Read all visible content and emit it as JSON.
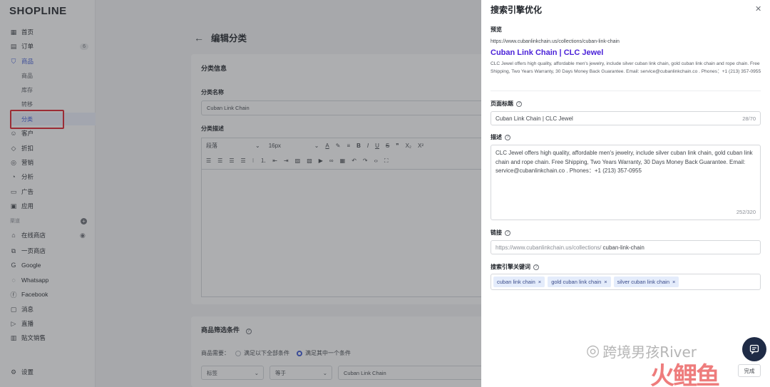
{
  "app": {
    "logo": "SHOPLINE"
  },
  "sidebar": {
    "items": [
      {
        "label": "首页",
        "icon": "dashboard-icon"
      },
      {
        "label": "订单",
        "icon": "order-icon",
        "badge": "6"
      },
      {
        "label": "商品",
        "icon": "bag-icon"
      },
      {
        "label": "客户",
        "icon": "user-icon"
      },
      {
        "label": "折扣",
        "icon": "tag-icon"
      },
      {
        "label": "营销",
        "icon": "marketing-icon"
      },
      {
        "label": "分析",
        "icon": "analytics-icon"
      },
      {
        "label": "广告",
        "icon": "ads-icon"
      },
      {
        "label": "应用",
        "icon": "apps-icon"
      }
    ],
    "sub_items": [
      "商品",
      "库存",
      "转移",
      "分类"
    ],
    "channel_label": "渠道",
    "channels": [
      {
        "label": "在线商店",
        "icon": "store-icon"
      },
      {
        "label": "一页商店",
        "icon": "onepage-icon"
      },
      {
        "label": "Google",
        "icon": "google-icon"
      },
      {
        "label": "Whatsapp",
        "icon": "whatsapp-icon"
      },
      {
        "label": "Facebook",
        "icon": "facebook-icon"
      },
      {
        "label": "消息",
        "icon": "message-icon"
      },
      {
        "label": "直播",
        "icon": "live-icon"
      },
      {
        "label": "贴文销售",
        "icon": "post-icon"
      }
    ],
    "settings": "设置"
  },
  "main": {
    "title": "编辑分类",
    "section_title": "分类信息",
    "name_label": "分类名称",
    "name_value": "Cuban Link Chain",
    "desc_label": "分类描述",
    "toolbar": {
      "paragraph": "段落",
      "font_size": "16px"
    },
    "filter_title": "商品筛选条件",
    "filter_need": "商品需要：",
    "filter_opt_all": "满足以下全部条件",
    "filter_opt_any": "满足其中一个条件",
    "filter_field": "标签",
    "filter_op": "等于",
    "filter_value": "Cuban Link Chain"
  },
  "panel": {
    "title": "搜索引擎优化",
    "preview_label": "预览",
    "preview_url": "https://www.cubanlinkchain.us/collections/cuban-link-chain",
    "preview_title": "Cuban Link Chain | CLC Jewel",
    "preview_desc": "CLC Jewel offers high quality, affordable men's jewelry, include silver cuban link chain, gold cuban link chain and rope chain. Free Shipping, Two Years Warranty, 30 Days Money Back Guarantee. Email: service@cubanlinkchain.co . Phones：+1 (213) 357-0955",
    "page_title_label": "页面标题",
    "page_title_value": "Cuban Link Chain | CLC Jewel",
    "page_title_count": "28/70",
    "desc_label": "描述",
    "desc_value": "CLC Jewel offers high quality, affordable men's jewelry, include silver cuban link chain, gold cuban link chain and rope chain. Free Shipping, Two Years Warranty, 30 Days Money Back Guarantee. Email: service@cubanlinkchain.co . Phones：+1 (213) 357-0955",
    "desc_count": "252/320",
    "link_label": "链接",
    "link_prefix": "https://www.cubanlinkchain.us/collections/",
    "link_value": "cuban-link-chain",
    "keywords_label": "搜索引擎关键词",
    "keywords": [
      "cuban link chain",
      "gold cuban link chain",
      "silver cuban link chain"
    ],
    "done": "完成"
  },
  "watermark": {
    "text": "跨境男孩River",
    "brand": "火鲤鱼"
  }
}
